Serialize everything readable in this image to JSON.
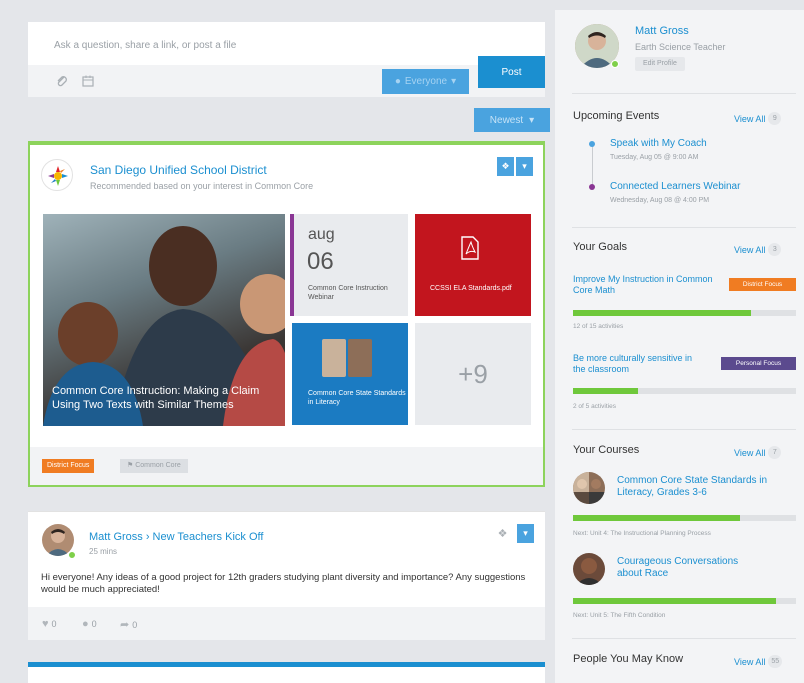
{
  "composer": {
    "placeholder": "Ask a question, share a link, or post a file",
    "audience_label": "Everyone",
    "post_label": "Post"
  },
  "feed": {
    "sort_label": "Newest",
    "cards": [
      {
        "org_name": "San Diego Unified School District",
        "subtitle": "Recommended based on your interest in Common Core",
        "photo_caption": "Common Core Instruction: Making a Claim Using Two Texts with Similar Themes",
        "event": {
          "month": "aug",
          "day": "06",
          "label": "Common Core Instruction Webinar"
        },
        "pdf_label": "CCSSI ELA Standards.pdf",
        "course_label": "Common Core State Standards in Literacy",
        "more_label": "+9",
        "badge": "District Focus",
        "tag": "Common Core"
      },
      {
        "author": "Matt Gross › New Teachers Kick Off",
        "time": "25 mins",
        "body": "Hi everyone! Any ideas of a good project for 12th graders studying plant diversity and importance? Any suggestions would be much appreciated!",
        "likes": "0",
        "comments": "0",
        "shares": "0"
      }
    ]
  },
  "profile": {
    "name": "Matt Gross",
    "role": "Earth Science Teacher",
    "edit_label": "Edit Profile"
  },
  "events": {
    "title": "Upcoming Events",
    "view_all": "View All",
    "count": "9",
    "items": [
      {
        "title": "Speak with My Coach",
        "date": "Tuesday, Aug 05 @ 9:00 AM"
      },
      {
        "title": "Connected Learners Webinar",
        "date": "Wednesday, Aug 08 @ 4:00 PM"
      }
    ]
  },
  "goals": {
    "title": "Your Goals",
    "view_all": "View All",
    "count": "3",
    "items": [
      {
        "title": "Improve My Instruction in Common Core Math",
        "badge": "District Focus",
        "badge_color": "#f07c22",
        "progress": 0.8,
        "meta": "12 of 15 activities"
      },
      {
        "title": "Be more culturally sensitive in the classroom",
        "badge": "Personal Focus",
        "badge_color": "#5b4a8e",
        "progress": 0.29,
        "meta": "2 of 5 activities"
      }
    ]
  },
  "courses": {
    "title": "Your Courses",
    "view_all": "View All",
    "count": "7",
    "items": [
      {
        "title": "Common Core State Standards in Literacy, Grades 3-6",
        "progress": 0.75,
        "meta": "Next: Unit 4: The Instructional Planning Process"
      },
      {
        "title": "Courageous Conversations about Race",
        "progress": 0.91,
        "meta": "Next: Unit 5: The Fifth Condition"
      }
    ]
  },
  "people": {
    "title": "People You May Know",
    "view_all": "View All",
    "count": "55"
  },
  "colors": {
    "accent": "#1b8fd0",
    "green": "#6fc83b",
    "purple_event": "#8a3694",
    "red_pdf": "#c2151e"
  }
}
